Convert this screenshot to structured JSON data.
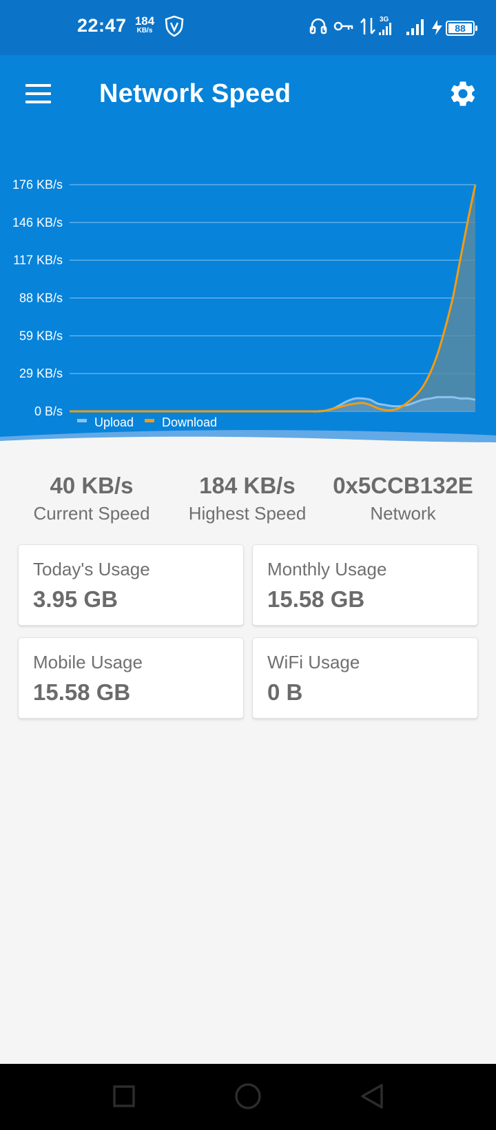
{
  "status_bar": {
    "time": "22:47",
    "speed_value": "184",
    "speed_unit": "KB/s",
    "network_type": "3G",
    "battery": "88",
    "icons": [
      "vpn-shield-icon",
      "headset-icon",
      "key-icon",
      "data-transfer-icon",
      "signal-icon",
      "charging-icon",
      "battery-icon"
    ]
  },
  "app_bar": {
    "title": "Network Speed",
    "menu_icon": "menu-icon",
    "settings_icon": "gear-icon"
  },
  "chart_data": {
    "type": "area",
    "y_tick_labels": [
      "0 B/s",
      "29 KB/s",
      "59 KB/s",
      "88 KB/s",
      "117 KB/s",
      "146 KB/s",
      "176 KB/s"
    ],
    "ylim": [
      0,
      176
    ],
    "y_unit": "KB/s",
    "grid": true,
    "legend_position": "bottom-left",
    "colors": {
      "upload": "#8dc3ee",
      "download": "#f39c12",
      "fill": "#5b8aa0"
    },
    "series": [
      {
        "name": "Upload",
        "values": [
          0,
          0,
          0,
          0,
          0,
          0,
          0,
          0,
          0,
          0,
          0,
          0,
          0,
          0,
          0,
          0,
          0,
          0,
          0,
          0,
          0,
          0,
          0,
          0,
          0,
          0,
          0,
          0,
          0,
          0,
          0,
          0,
          0,
          0,
          0.5,
          2,
          5,
          8,
          10,
          10,
          9,
          6,
          5,
          4,
          4,
          5,
          7,
          9,
          10,
          11,
          11,
          11,
          10,
          10,
          9
        ]
      },
      {
        "name": "Download",
        "values": [
          0,
          0,
          0,
          0,
          0,
          0,
          0,
          0,
          0,
          0,
          0,
          0,
          0,
          0,
          0,
          0,
          0,
          0,
          0,
          0,
          0,
          0,
          0,
          0,
          0,
          0,
          0,
          0,
          0,
          0,
          0,
          0,
          0,
          0,
          0.5,
          2,
          3.5,
          5,
          6,
          6.5,
          5,
          2.5,
          1,
          1,
          3,
          7,
          12,
          19,
          30,
          45,
          65,
          88,
          118,
          148,
          176
        ]
      }
    ]
  },
  "stats": [
    {
      "value": "40 KB/s",
      "label": "Current Speed"
    },
    {
      "value": "184 KB/s",
      "label": "Highest Speed"
    },
    {
      "value": "0x5CCB132E",
      "label": "Network"
    }
  ],
  "cards": [
    {
      "label": "Today's Usage",
      "value": "3.95 GB"
    },
    {
      "label": "Monthly Usage",
      "value": "15.58 GB"
    },
    {
      "label": "Mobile Usage",
      "value": "15.58 GB"
    },
    {
      "label": "WiFi Usage",
      "value": "0 B"
    }
  ],
  "nav_bar": {
    "buttons": [
      "recents-square-icon",
      "home-circle-icon",
      "back-triangle-icon"
    ]
  }
}
